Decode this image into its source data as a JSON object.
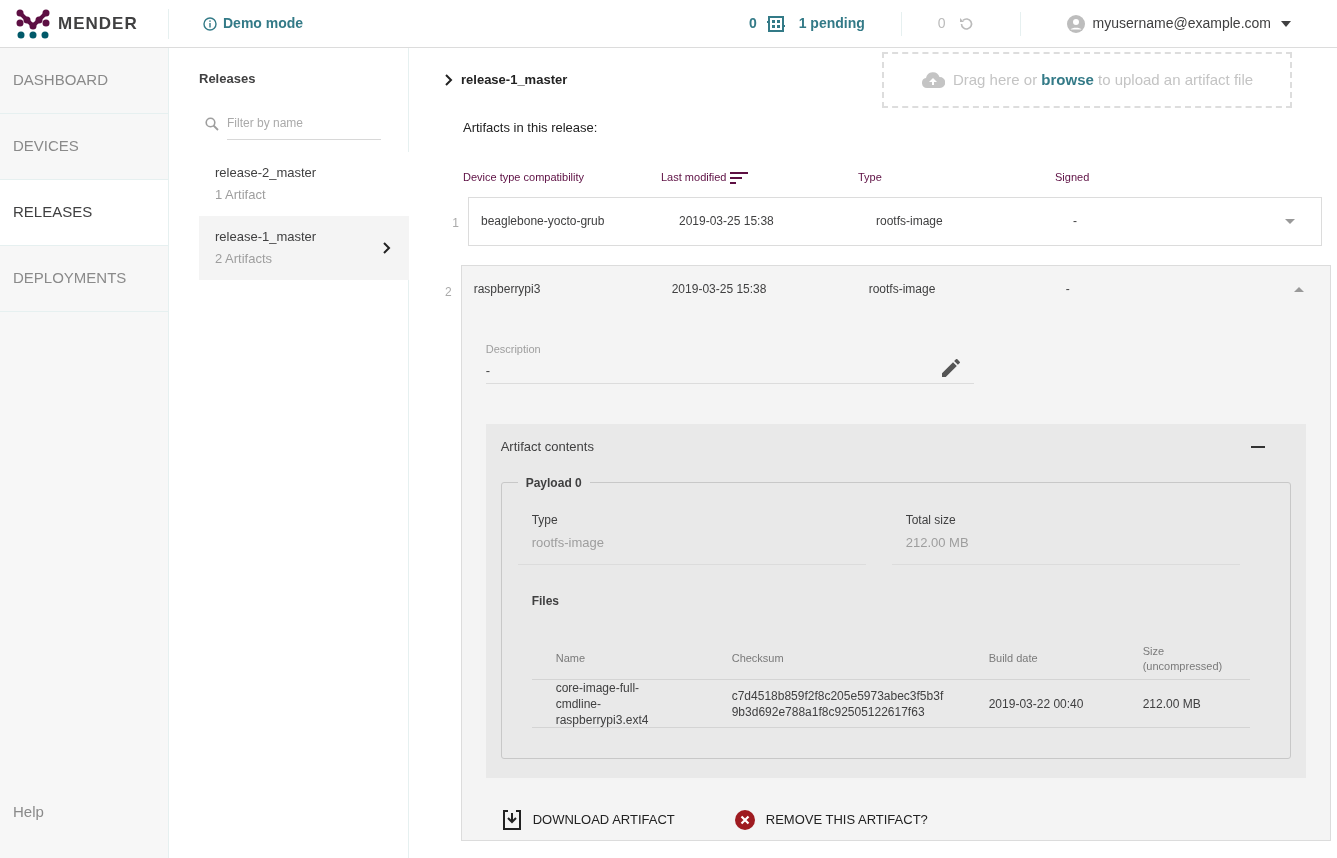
{
  "header": {
    "logo_text": "MENDER",
    "demo_mode": "Demo mode",
    "devices_count": "0",
    "pending": "1 pending",
    "deployments_count": "0",
    "user": "myusername@example.com"
  },
  "nav": {
    "items": [
      {
        "label": "DASHBOARD",
        "selected": false
      },
      {
        "label": "DEVICES",
        "selected": false
      },
      {
        "label": "RELEASES",
        "selected": true
      },
      {
        "label": "DEPLOYMENTS",
        "selected": false
      }
    ],
    "help": "Help"
  },
  "releases": {
    "title": "Releases",
    "filter_placeholder": "Filter by name",
    "items": [
      {
        "name": "release-2_master",
        "artifacts": "1 Artifact",
        "selected": false
      },
      {
        "name": "release-1_master",
        "artifacts": "2 Artifacts",
        "selected": true
      }
    ]
  },
  "release": {
    "name": "release-1_master",
    "upload_prefix": "Drag here or",
    "upload_link": "browse",
    "upload_suffix": "to upload an artifact file",
    "artifacts_label": "Artifacts in this release:",
    "columns": [
      {
        "label": "Device type compatibility",
        "sorted": false
      },
      {
        "label": "Last modified",
        "sorted": true
      },
      {
        "label": "Type",
        "sorted": false
      },
      {
        "label": "Signed",
        "sorted": false
      }
    ],
    "artifacts": [
      {
        "index": "1",
        "device_type": "beaglebone-yocto-grub",
        "modified": "2019-03-25 15:38",
        "type": "rootfs-image",
        "signed": "-",
        "expanded": false
      },
      {
        "index": "2",
        "device_type": "raspberrypi3",
        "modified": "2019-03-25 15:38",
        "type": "rootfs-image",
        "signed": "-",
        "expanded": true,
        "details": {
          "description_label": "Description",
          "description": "-",
          "contents_title": "Artifact contents",
          "payload_title": "Payload 0",
          "type_label": "Type",
          "type": "rootfs-image",
          "size_label": "Total size",
          "size": "212.00 MB",
          "files_title": "Files",
          "file_columns": [
            "Name",
            "Checksum",
            "Build date",
            "Size (uncompressed)"
          ],
          "files": [
            {
              "name": "core-image-full-cmdline-raspberrypi3.ext4",
              "checksum": "c7d4518b859f2f8c205e5973abec3f5b3f9b3d692e788a1f8c92505122617f63",
              "build_date": "2019-03-22 00:40",
              "size": "212.00 MB"
            }
          ],
          "download": "DOWNLOAD ARTIFACT",
          "remove": "REMOVE THIS ARTIFACT?"
        }
      }
    ]
  }
}
